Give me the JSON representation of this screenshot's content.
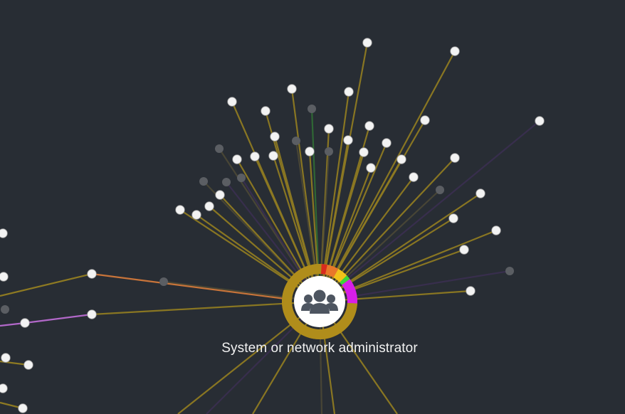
{
  "hub": {
    "label": "System or network administrator",
    "icon": "users-group-icon",
    "ring_color": "#b08d1b",
    "segments": [
      {
        "color": "#d92b1e",
        "fraction": 0.025
      },
      {
        "color": "#e8782a",
        "fraction": 0.05
      },
      {
        "color": "#f0c21a",
        "fraction": 0.045
      },
      {
        "color": "#3bd43a",
        "fraction": 0.02
      },
      {
        "color": "#d81ee8",
        "fraction": 0.11
      },
      {
        "color": "#b08d1b",
        "fraction": 0.75
      }
    ]
  },
  "colors": {
    "background": "#282d34",
    "edge_default": "#8e7a22",
    "edge_dim": "#4e4a36",
    "edge_orange": "#c8743a",
    "edge_purple": "#b268c9",
    "edge_dim_purple": "#3b2f52",
    "edge_green": "#2f6a35",
    "node_fill": "#f3f3f3",
    "node_dim": "#5b5e63"
  }
}
